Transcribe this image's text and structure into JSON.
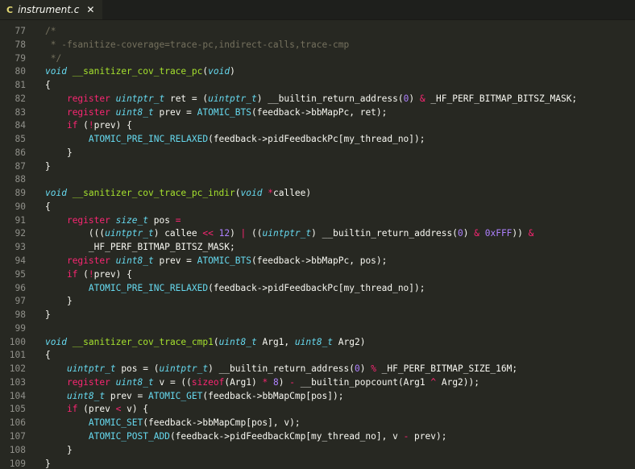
{
  "tab": {
    "icon": "C",
    "filename": "instrument.c",
    "close": "✕"
  },
  "lines": [
    {
      "n": "77",
      "tokens": [
        [
          "cm",
          "/*"
        ]
      ]
    },
    {
      "n": "78",
      "tokens": [
        [
          "cm",
          " * -fsanitize-coverage=trace-pc,indirect-calls,trace-cmp"
        ]
      ]
    },
    {
      "n": "79",
      "tokens": [
        [
          "cm",
          " */"
        ]
      ]
    },
    {
      "n": "80",
      "tokens": [
        [
          "ty",
          "void"
        ],
        [
          "tx",
          " "
        ],
        [
          "fn",
          "__sanitizer_cov_trace_pc"
        ],
        [
          "tx",
          "("
        ],
        [
          "ty",
          "void"
        ],
        [
          "tx",
          ")"
        ]
      ]
    },
    {
      "n": "81",
      "tokens": [
        [
          "tx",
          "{"
        ]
      ]
    },
    {
      "n": "82",
      "tokens": [
        [
          "tx",
          "    "
        ],
        [
          "kw",
          "register"
        ],
        [
          "tx",
          " "
        ],
        [
          "ty",
          "uintptr_t"
        ],
        [
          "tx",
          " ret = ("
        ],
        [
          "ty",
          "uintptr_t"
        ],
        [
          "tx",
          ") __builtin_return_address("
        ],
        [
          "num",
          "0"
        ],
        [
          "tx",
          ") "
        ],
        [
          "op",
          "&"
        ],
        [
          "tx",
          " _HF_PERF_BITMAP_BITSZ_MASK;"
        ]
      ]
    },
    {
      "n": "83",
      "tokens": [
        [
          "tx",
          "    "
        ],
        [
          "kw",
          "register"
        ],
        [
          "tx",
          " "
        ],
        [
          "ty",
          "uint8_t"
        ],
        [
          "tx",
          " prev = "
        ],
        [
          "mac",
          "ATOMIC_BTS"
        ],
        [
          "tx",
          "(feedback->bbMapPc, ret);"
        ]
      ]
    },
    {
      "n": "84",
      "tokens": [
        [
          "tx",
          "    "
        ],
        [
          "kw",
          "if"
        ],
        [
          "tx",
          " ("
        ],
        [
          "op",
          "!"
        ],
        [
          "tx",
          "prev) {"
        ]
      ]
    },
    {
      "n": "85",
      "tokens": [
        [
          "tx",
          "        "
        ],
        [
          "mac",
          "ATOMIC_PRE_INC_RELAXED"
        ],
        [
          "tx",
          "(feedback->pidFeedbackPc[my_thread_no]);"
        ]
      ]
    },
    {
      "n": "86",
      "tokens": [
        [
          "tx",
          "    }"
        ]
      ]
    },
    {
      "n": "87",
      "tokens": [
        [
          "tx",
          "}"
        ]
      ]
    },
    {
      "n": "88",
      "tokens": []
    },
    {
      "n": "89",
      "tokens": [
        [
          "ty",
          "void"
        ],
        [
          "tx",
          " "
        ],
        [
          "fn",
          "__sanitizer_cov_trace_pc_indir"
        ],
        [
          "tx",
          "("
        ],
        [
          "ty",
          "void"
        ],
        [
          "tx",
          " "
        ],
        [
          "op",
          "*"
        ],
        [
          "tx",
          "callee)"
        ]
      ]
    },
    {
      "n": "90",
      "tokens": [
        [
          "tx",
          "{"
        ]
      ]
    },
    {
      "n": "91",
      "tokens": [
        [
          "tx",
          "    "
        ],
        [
          "kw",
          "register"
        ],
        [
          "tx",
          " "
        ],
        [
          "ty",
          "size_t"
        ],
        [
          "tx",
          " pos "
        ],
        [
          "op",
          "="
        ]
      ]
    },
    {
      "n": "92",
      "tokens": [
        [
          "tx",
          "        ((("
        ],
        [
          "ty",
          "uintptr_t"
        ],
        [
          "tx",
          ") callee "
        ],
        [
          "op",
          "<<"
        ],
        [
          "tx",
          " "
        ],
        [
          "num",
          "12"
        ],
        [
          "tx",
          ") "
        ],
        [
          "op",
          "|"
        ],
        [
          "tx",
          " (("
        ],
        [
          "ty",
          "uintptr_t"
        ],
        [
          "tx",
          ") __builtin_return_address("
        ],
        [
          "num",
          "0"
        ],
        [
          "tx",
          ") "
        ],
        [
          "op",
          "&"
        ],
        [
          "tx",
          " "
        ],
        [
          "num",
          "0xFFF"
        ],
        [
          "tx",
          ")) "
        ],
        [
          "op",
          "&"
        ]
      ]
    },
    {
      "n": "93",
      "tokens": [
        [
          "tx",
          "        _HF_PERF_BITMAP_BITSZ_MASK;"
        ]
      ]
    },
    {
      "n": "94",
      "tokens": [
        [
          "tx",
          "    "
        ],
        [
          "kw",
          "register"
        ],
        [
          "tx",
          " "
        ],
        [
          "ty",
          "uint8_t"
        ],
        [
          "tx",
          " prev = "
        ],
        [
          "mac",
          "ATOMIC_BTS"
        ],
        [
          "tx",
          "(feedback->bbMapPc, pos);"
        ]
      ]
    },
    {
      "n": "95",
      "tokens": [
        [
          "tx",
          "    "
        ],
        [
          "kw",
          "if"
        ],
        [
          "tx",
          " ("
        ],
        [
          "op",
          "!"
        ],
        [
          "tx",
          "prev) {"
        ]
      ]
    },
    {
      "n": "96",
      "tokens": [
        [
          "tx",
          "        "
        ],
        [
          "mac",
          "ATOMIC_PRE_INC_RELAXED"
        ],
        [
          "tx",
          "(feedback->pidFeedbackPc[my_thread_no]);"
        ]
      ]
    },
    {
      "n": "97",
      "tokens": [
        [
          "tx",
          "    }"
        ]
      ]
    },
    {
      "n": "98",
      "tokens": [
        [
          "tx",
          "}"
        ]
      ]
    },
    {
      "n": "99",
      "tokens": []
    },
    {
      "n": "100",
      "tokens": [
        [
          "ty",
          "void"
        ],
        [
          "tx",
          " "
        ],
        [
          "fn",
          "__sanitizer_cov_trace_cmp1"
        ],
        [
          "tx",
          "("
        ],
        [
          "ty",
          "uint8_t"
        ],
        [
          "tx",
          " Arg1, "
        ],
        [
          "ty",
          "uint8_t"
        ],
        [
          "tx",
          " Arg2)"
        ]
      ]
    },
    {
      "n": "101",
      "tokens": [
        [
          "tx",
          "{"
        ]
      ]
    },
    {
      "n": "102",
      "tokens": [
        [
          "tx",
          "    "
        ],
        [
          "ty",
          "uintptr_t"
        ],
        [
          "tx",
          " pos = ("
        ],
        [
          "ty",
          "uintptr_t"
        ],
        [
          "tx",
          ") __builtin_return_address("
        ],
        [
          "num",
          "0"
        ],
        [
          "tx",
          ") "
        ],
        [
          "op",
          "%"
        ],
        [
          "tx",
          " _HF_PERF_BITMAP_SIZE_16M;"
        ]
      ]
    },
    {
      "n": "103",
      "tokens": [
        [
          "tx",
          "    "
        ],
        [
          "kw",
          "register"
        ],
        [
          "tx",
          " "
        ],
        [
          "ty",
          "uint8_t"
        ],
        [
          "tx",
          " v = (("
        ],
        [
          "kw",
          "sizeof"
        ],
        [
          "tx",
          "(Arg1) "
        ],
        [
          "op",
          "*"
        ],
        [
          "tx",
          " "
        ],
        [
          "num",
          "8"
        ],
        [
          "tx",
          ") "
        ],
        [
          "op",
          "-"
        ],
        [
          "tx",
          " __builtin_popcount(Arg1 "
        ],
        [
          "op",
          "^"
        ],
        [
          "tx",
          " Arg2));"
        ]
      ]
    },
    {
      "n": "104",
      "tokens": [
        [
          "tx",
          "    "
        ],
        [
          "ty",
          "uint8_t"
        ],
        [
          "tx",
          " prev = "
        ],
        [
          "mac",
          "ATOMIC_GET"
        ],
        [
          "tx",
          "(feedback->bbMapCmp[pos]);"
        ]
      ]
    },
    {
      "n": "105",
      "tokens": [
        [
          "tx",
          "    "
        ],
        [
          "kw",
          "if"
        ],
        [
          "tx",
          " (prev "
        ],
        [
          "op",
          "<"
        ],
        [
          "tx",
          " v) {"
        ]
      ]
    },
    {
      "n": "106",
      "tokens": [
        [
          "tx",
          "        "
        ],
        [
          "mac",
          "ATOMIC_SET"
        ],
        [
          "tx",
          "(feedback->bbMapCmp[pos], v);"
        ]
      ]
    },
    {
      "n": "107",
      "tokens": [
        [
          "tx",
          "        "
        ],
        [
          "mac",
          "ATOMIC_POST_ADD"
        ],
        [
          "tx",
          "(feedback->pidFeedbackCmp[my_thread_no], v "
        ],
        [
          "op",
          "-"
        ],
        [
          "tx",
          " prev);"
        ]
      ]
    },
    {
      "n": "108",
      "tokens": [
        [
          "tx",
          "    }"
        ]
      ]
    },
    {
      "n": "109",
      "tokens": [
        [
          "tx",
          "}"
        ]
      ]
    }
  ],
  "colors": {
    "background": "#272822",
    "keyword": "#f92672",
    "type": "#66d9ef",
    "function": "#a6e22e",
    "number": "#ae81ff",
    "comment": "#75715e",
    "text": "#f8f8f2"
  }
}
